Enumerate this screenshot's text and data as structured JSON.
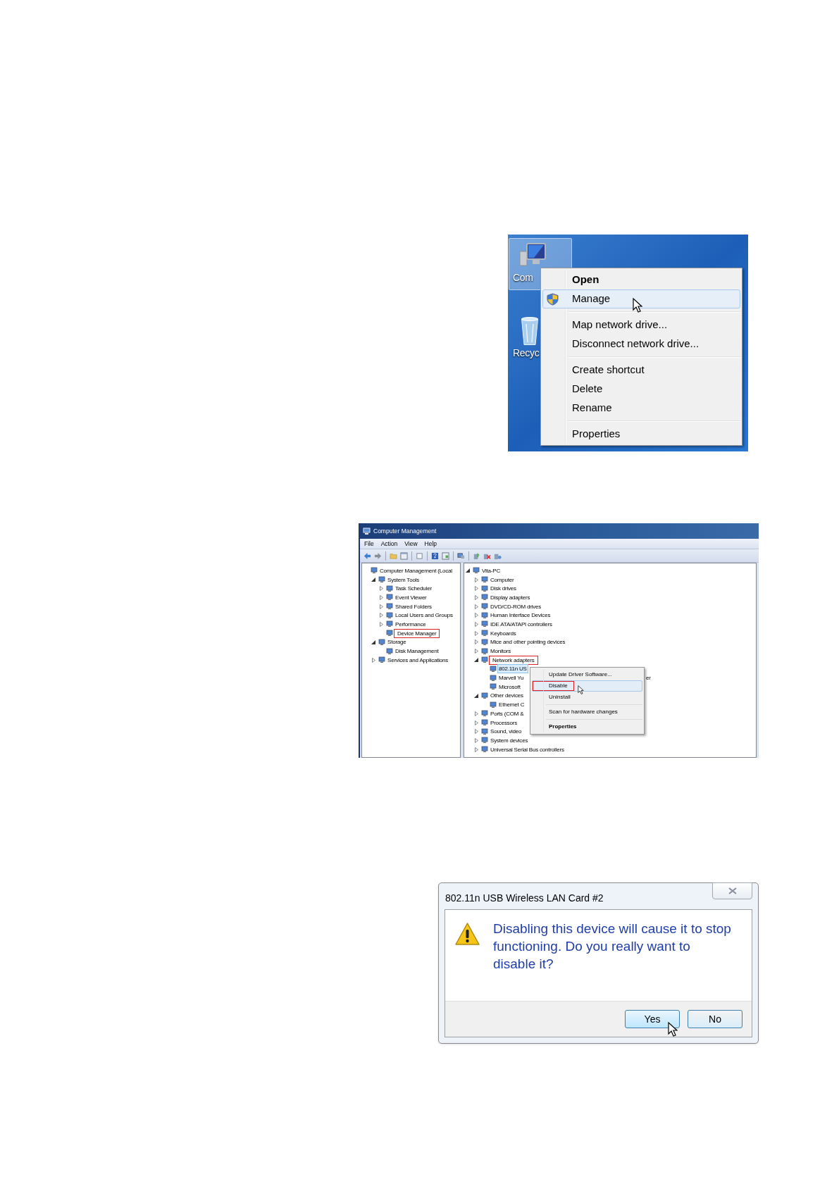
{
  "desktop_screenshot": {
    "icons": [
      {
        "label": "Com",
        "kind": "computer",
        "selected": true
      },
      {
        "label": "Recyc",
        "kind": "recycle-bin",
        "selected": false
      }
    ],
    "context_menu": {
      "items": [
        {
          "kind": "item",
          "label": "Open",
          "bold": true,
          "selected": false
        },
        {
          "kind": "item",
          "label": "Manage",
          "bold": false,
          "selected": true,
          "shield": true
        },
        {
          "kind": "separator"
        },
        {
          "kind": "item",
          "label": "Map network drive...",
          "bold": false,
          "selected": false
        },
        {
          "kind": "item",
          "label": "Disconnect network drive...",
          "bold": false,
          "selected": false
        },
        {
          "kind": "separator"
        },
        {
          "kind": "item",
          "label": "Create shortcut",
          "bold": false,
          "selected": false
        },
        {
          "kind": "item",
          "label": "Delete",
          "bold": false,
          "selected": false
        },
        {
          "kind": "item",
          "label": "Rename",
          "bold": false,
          "selected": false
        },
        {
          "kind": "separator"
        },
        {
          "kind": "item",
          "label": "Properties",
          "bold": false,
          "selected": false
        }
      ]
    }
  },
  "computer_management": {
    "window": {
      "title": "Computer Management"
    },
    "menu": [
      "File",
      "Action",
      "View",
      "Help"
    ],
    "left_tree": [
      {
        "label": "Computer Management (Local",
        "selected": false,
        "boxed": false,
        "children": [
          {
            "label": "System Tools",
            "expanded": true,
            "selected": false,
            "boxed": false,
            "children": [
              {
                "label": "Task Scheduler",
                "expanded": false,
                "selected": false,
                "boxed": false
              },
              {
                "label": "Event Viewer",
                "expanded": false,
                "selected": false,
                "boxed": false
              },
              {
                "label": "Shared Folders",
                "expanded": false,
                "selected": false,
                "boxed": false
              },
              {
                "label": "Local Users and Groups",
                "expanded": false,
                "selected": false,
                "boxed": false
              },
              {
                "label": "Performance",
                "expanded": false,
                "selected": false,
                "boxed": false
              },
              {
                "label": "Device Manager",
                "selected": false,
                "boxed": true
              }
            ]
          },
          {
            "label": "Storage",
            "expanded": true,
            "selected": false,
            "boxed": false,
            "children": [
              {
                "label": "Disk Management",
                "selected": false,
                "boxed": false
              }
            ]
          },
          {
            "label": "Services and Applications",
            "expanded": false,
            "selected": false,
            "boxed": false
          }
        ]
      }
    ],
    "right_tree": [
      {
        "label": "Vita-PC",
        "expanded": true,
        "selected": false,
        "boxed": false,
        "children": [
          {
            "label": "Computer",
            "expanded": false,
            "selected": false,
            "boxed": false
          },
          {
            "label": "Disk drives",
            "expanded": false,
            "selected": false,
            "boxed": false
          },
          {
            "label": "Display adapters",
            "expanded": false,
            "selected": false,
            "boxed": false
          },
          {
            "label": "DVD/CD-ROM drives",
            "expanded": false,
            "selected": false,
            "boxed": false
          },
          {
            "label": "Human Interface Devices",
            "expanded": false,
            "selected": false,
            "boxed": false
          },
          {
            "label": "IDE ATA/ATAPI controllers",
            "expanded": false,
            "selected": false,
            "boxed": false
          },
          {
            "label": "Keyboards",
            "expanded": false,
            "selected": false,
            "boxed": false
          },
          {
            "label": "Mice and other pointing devices",
            "expanded": false,
            "selected": false,
            "boxed": false
          },
          {
            "label": "Monitors",
            "expanded": false,
            "selected": false,
            "boxed": false
          },
          {
            "label": "Network adapters",
            "expanded": true,
            "selected": false,
            "boxed": true,
            "children": [
              {
                "label": "802.11n US",
                "selected": true,
                "boxed": false
              },
              {
                "label": "Marvell Yu",
                "selected": false,
                "boxed": false,
                "tail": "er"
              },
              {
                "label": "Microsoft",
                "selected": false,
                "boxed": false
              }
            ]
          },
          {
            "label": "Other devices",
            "expanded": true,
            "selected": false,
            "boxed": false,
            "children": [
              {
                "label": "Ethernet C",
                "selected": false,
                "boxed": false
              }
            ]
          },
          {
            "label": "Ports (COM &",
            "expanded": false,
            "selected": false,
            "boxed": false
          },
          {
            "label": "Processors",
            "expanded": false,
            "selected": false,
            "boxed": false
          },
          {
            "label": "Sound, video",
            "expanded": false,
            "selected": false,
            "boxed": false
          },
          {
            "label": "System devices",
            "expanded": false,
            "selected": false,
            "boxed": false
          },
          {
            "label": "Universal Serial Bus controllers",
            "expanded": false,
            "selected": false,
            "boxed": false
          }
        ]
      }
    ],
    "context_menu": {
      "items": [
        {
          "kind": "item",
          "label": "Update Driver Software...",
          "bold": false,
          "selected": false,
          "boxed": false
        },
        {
          "kind": "item",
          "label": "Disable",
          "bold": false,
          "selected": true,
          "boxed": true
        },
        {
          "kind": "item",
          "label": "Uninstall",
          "bold": false,
          "selected": false,
          "boxed": false
        },
        {
          "kind": "separator"
        },
        {
          "kind": "item",
          "label": "Scan for hardware changes",
          "bold": false,
          "selected": false,
          "boxed": false
        },
        {
          "kind": "separator"
        },
        {
          "kind": "item",
          "label": "Properties",
          "bold": true,
          "selected": false,
          "boxed": false
        }
      ]
    }
  },
  "confirm_dialog": {
    "title": "802.11n USB Wireless LAN Card #2",
    "message": "Disabling this device will cause it to stop functioning. Do you really want to disable it?",
    "buttons": [
      {
        "label": "Yes",
        "hovered": true
      },
      {
        "label": "No",
        "hovered": false
      }
    ]
  }
}
